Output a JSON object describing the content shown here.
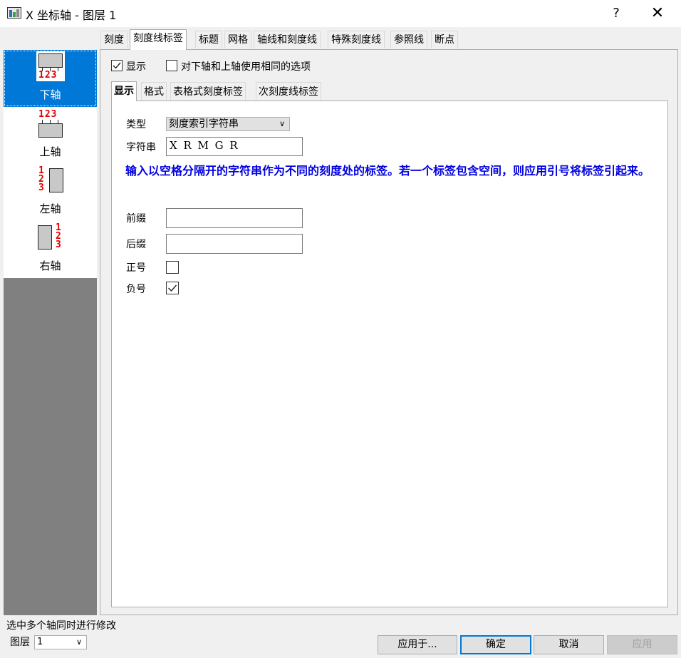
{
  "window": {
    "title": "X 坐标轴 - 图层 1",
    "help": "?",
    "close": "✕"
  },
  "outer_tabs": [
    "刻度",
    "刻度线标签",
    "标题",
    "网格",
    "轴线和刻度线",
    "特殊刻度线",
    "参照线",
    "断点"
  ],
  "outer_active": 1,
  "sidebar": {
    "items": [
      {
        "label": "下轴",
        "digits": "123",
        "selected": true
      },
      {
        "label": "上轴",
        "digits": "123",
        "selected": false
      },
      {
        "label": "左轴",
        "digits": "123",
        "selected": false
      },
      {
        "label": "右轴",
        "digits": "123",
        "selected": false
      }
    ]
  },
  "show_checkbox": {
    "label": "显示",
    "checked": true
  },
  "same_options_checkbox": {
    "label": "对下轴和上轴使用相同的选项",
    "checked": false
  },
  "inner_tabs": [
    "显示",
    "格式",
    "表格式刻度标签",
    "次刻度线标签"
  ],
  "inner_active": 0,
  "form": {
    "type_label": "类型",
    "type_value": "刻度索引字符串",
    "string_label": "字符串",
    "string_value": "X R M G R",
    "help_text": "输入以空格分隔开的字符串作为不同的刻度处的标签。若一个标签包含空间，则应用引号将标签引起来。",
    "prefix_label": "前缀",
    "prefix_value": "",
    "suffix_label": "后缀",
    "suffix_value": "",
    "plus_label": "正号",
    "plus_checked": false,
    "minus_label": "负号",
    "minus_checked": true
  },
  "footer": {
    "status": "选中多个轴同时进行修改",
    "layer_label": "图层",
    "layer_value": "1",
    "apply_to": "应用于...",
    "ok": "确定",
    "cancel": "取消",
    "apply": "应用"
  },
  "colors": {
    "accent": "#0078d7",
    "help_text": "#0000e0",
    "digits": "#e00000"
  }
}
